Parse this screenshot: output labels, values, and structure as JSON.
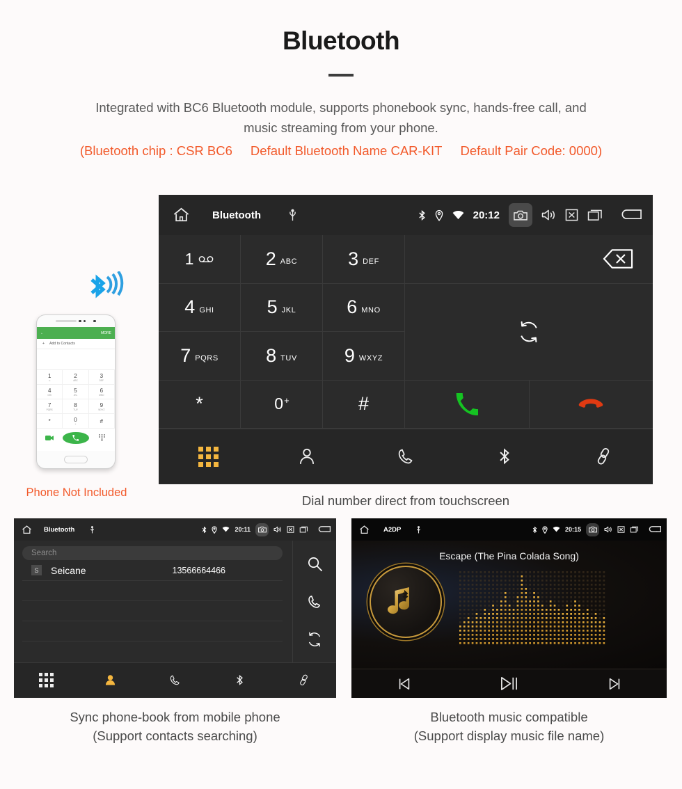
{
  "header": {
    "title": "Bluetooth",
    "intro_line1": "Integrated with BC6 Bluetooth module, supports phonebook sync, hands-free call, and",
    "intro_line2": "music streaming from your phone.",
    "spec_chip": "(Bluetooth chip : CSR BC6",
    "spec_name": "Default Bluetooth Name CAR-KIT",
    "spec_pair": "Default Pair Code: 0000)"
  },
  "colors": {
    "accent_orange": "#f2592a",
    "active_amber": "#f4b63f",
    "call_green": "#15c322",
    "hangup_red": "#e03a12",
    "screen_bg": "#2b2b2b",
    "statusbar_bg": "#262626"
  },
  "dialer": {
    "statusbar": {
      "home_icon": "home-icon",
      "title": "Bluetooth",
      "usb_icon": "usb-icon",
      "bluetooth_icon": "bluetooth-icon",
      "location_icon": "location-icon",
      "wifi_icon": "wifi-icon",
      "time": "20:12",
      "camera_icon": "camera-icon",
      "volume_icon": "volume-icon",
      "close-box_icon": "close-box-icon",
      "recents_icon": "recent-apps-icon",
      "back_icon": "back-arrow-icon"
    },
    "keys": [
      {
        "digit": "1",
        "letters": "",
        "glyph": "voicemail"
      },
      {
        "digit": "2",
        "letters": "ABC",
        "glyph": ""
      },
      {
        "digit": "3",
        "letters": "DEF",
        "glyph": ""
      },
      {
        "digit": "4",
        "letters": "GHI",
        "glyph": ""
      },
      {
        "digit": "5",
        "letters": "JKL",
        "glyph": ""
      },
      {
        "digit": "6",
        "letters": "MNO",
        "glyph": ""
      },
      {
        "digit": "7",
        "letters": "PQRS",
        "glyph": ""
      },
      {
        "digit": "8",
        "letters": "TUV",
        "glyph": ""
      },
      {
        "digit": "9",
        "letters": "WXYZ",
        "glyph": ""
      },
      {
        "digit": "*",
        "letters": "",
        "glyph": ""
      },
      {
        "digit": "0",
        "letters": "",
        "glyph": "plus"
      },
      {
        "digit": "#",
        "letters": "",
        "glyph": ""
      }
    ],
    "backspace_icon": "backspace-icon",
    "sync_icon": "sync-icon",
    "call_icon": "call-icon",
    "hangup_icon": "hangup-icon",
    "nav": [
      {
        "name": "keypad",
        "icon": "keypad-icon",
        "active": true
      },
      {
        "name": "contacts",
        "icon": "person-icon",
        "active": false
      },
      {
        "name": "call-log",
        "icon": "phone-handset-icon",
        "active": false
      },
      {
        "name": "bluetooth",
        "icon": "bluetooth-icon",
        "active": false
      },
      {
        "name": "link",
        "icon": "link-icon",
        "active": false
      }
    ],
    "caption": "Dial number direct from touchscreen"
  },
  "phone_mock": {
    "more_label": "MORE",
    "add_label": "Add to Contacts",
    "keys": [
      {
        "d": "1",
        "s": "∞"
      },
      {
        "d": "2",
        "s": "ABC"
      },
      {
        "d": "3",
        "s": "DEF"
      },
      {
        "d": "4",
        "s": "GHI"
      },
      {
        "d": "5",
        "s": "JKL"
      },
      {
        "d": "6",
        "s": "MNO"
      },
      {
        "d": "7",
        "s": "PQRS"
      },
      {
        "d": "8",
        "s": "TUV"
      },
      {
        "d": "9",
        "s": "WXYZ"
      },
      {
        "d": "*",
        "s": ""
      },
      {
        "d": "0",
        "s": "+"
      },
      {
        "d": "#",
        "s": ""
      }
    ],
    "not_included_label": "Phone Not Included",
    "bluetooth_logo_icon": "bluetooth-wireless-icon"
  },
  "contacts": {
    "statusbar": {
      "title": "Bluetooth",
      "time": "20:11"
    },
    "search_placeholder": "Search",
    "rows": [
      {
        "avatar": "S",
        "name": "Seicane",
        "number": "13566664466"
      }
    ],
    "side_icons": [
      {
        "name": "search",
        "icon": "search-icon"
      },
      {
        "name": "call",
        "icon": "phone-handset-icon"
      },
      {
        "name": "sync",
        "icon": "sync-icon"
      }
    ],
    "nav": [
      {
        "name": "keypad",
        "icon": "keypad-icon",
        "active": false
      },
      {
        "name": "contacts",
        "icon": "person-filled-icon",
        "active": true
      },
      {
        "name": "call-log",
        "icon": "phone-handset-icon",
        "active": false
      },
      {
        "name": "bluetooth",
        "icon": "bluetooth-icon",
        "active": false
      },
      {
        "name": "link",
        "icon": "link-icon",
        "active": false
      }
    ],
    "caption_line1": "Sync phone-book from mobile phone",
    "caption_line2": "(Support contacts searching)"
  },
  "music": {
    "statusbar": {
      "title": "A2DP",
      "time": "20:15"
    },
    "song_title": "Escape (The Pina Colada Song)",
    "album_icon": "music-note-bluetooth-icon",
    "controls": [
      {
        "name": "previous",
        "icon": "skip-previous-icon"
      },
      {
        "name": "play-pause",
        "icon": "play-pause-icon"
      },
      {
        "name": "next",
        "icon": "skip-next-icon"
      }
    ],
    "caption_line1": "Bluetooth music compatible",
    "caption_line2": "(Support display music file name)"
  }
}
